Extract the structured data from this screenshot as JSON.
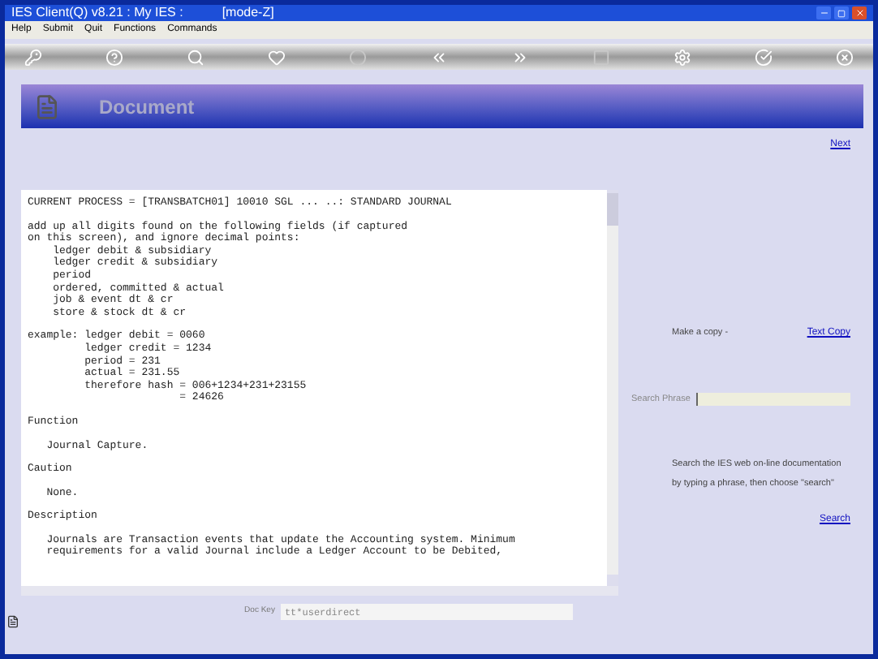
{
  "window": {
    "title": "IES Client(Q) v8.21 : My IES :",
    "mode": "[mode-Z]"
  },
  "menu": [
    "Help",
    "Submit",
    "Quit",
    "Functions",
    "Commands"
  ],
  "header": {
    "title": "Document"
  },
  "next_link": "Next",
  "document": {
    "blocks": [
      {
        "lines": [
          "CURRENT PROCESS = [TRANSBATCH01] 10010 SGL ... ..: STANDARD JOURNAL"
        ]
      },
      {
        "lines": [
          "add up all digits found on the following fields (if captured",
          "on this screen), and ignore decimal points:",
          "    ledger debit & subsidiary",
          "    ledger credit & subsidiary",
          "    period",
          "    ordered, committed & actual",
          "    job & event dt & cr",
          "    store & stock dt & cr"
        ]
      },
      {
        "lines": [
          "example: ledger debit = 0060",
          "         ledger credit = 1234",
          "         period = 231",
          "         actual = 231.55",
          "         therefore hash = 006+1234+231+23155",
          "                        = 24626"
        ]
      },
      {
        "lines": [
          "Function"
        ]
      },
      {
        "lines": [
          "   Journal Capture."
        ]
      },
      {
        "lines": [
          "Caution"
        ]
      },
      {
        "lines": [
          "   None."
        ]
      },
      {
        "lines": [
          "Description"
        ]
      },
      {
        "lines": [
          "   Journals are Transaction events that update the Accounting system. Minimum",
          "   requirements for a valid Journal include a Ledger Account to be Debited,"
        ]
      }
    ]
  },
  "doc_key": {
    "label": "Doc Key",
    "value": "tt*userdirect"
  },
  "copy": {
    "label": "Make a copy -",
    "link": "Text Copy"
  },
  "search": {
    "label": "Search Phrase",
    "hint": "Search the IES web on-line documentation",
    "hint2": "by typing a phrase, then choose \"search\"",
    "link": "Search"
  }
}
